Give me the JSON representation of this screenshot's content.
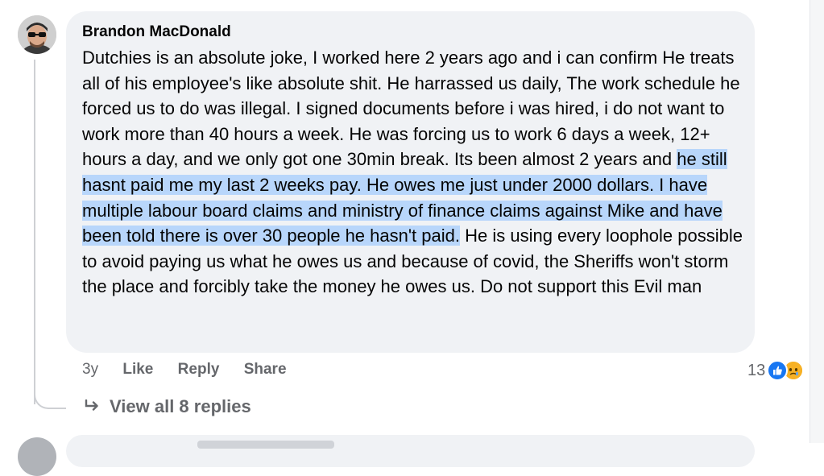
{
  "comment": {
    "author": "Brandon MacDonald",
    "text_before": "Dutchies is an absolute joke, I worked here 2 years ago and i can confirm He treats all of his employee's like absolute shit. He harrassed us daily, The work schedule he forced us to do was illegal. I signed documents before i was hired, i do not want to work more than 40 hours a week. He was forcing us to work 6 days a week, 12+ hours a day, and we only got one 30min break. Its been almost 2 years and ",
    "text_highlighted": "he still hasnt paid me my last 2 weeks pay. He owes me just under 2000 dollars. I have multiple labour board claims and ministry of finance claims against Mike and have been told there is over 30 people he hasn't paid.",
    "text_after": " He is using every loophole possible to avoid paying us what he owes us and because of covid, the Sheriffs won't storm the place and forcibly take the money he owes us. Do not support this Evil man",
    "highlight_color": "#b8d6fb"
  },
  "actions": {
    "time": "3y",
    "like": "Like",
    "reply": "Reply",
    "share": "Share"
  },
  "reactions": {
    "count": "13",
    "icons": [
      "like-icon",
      "sad-icon"
    ]
  },
  "replies": {
    "label": "View all 8 replies"
  },
  "colors": {
    "bubble": "#f0f2f5",
    "secondary_text": "#65676b",
    "like_blue": "#1877f2"
  }
}
